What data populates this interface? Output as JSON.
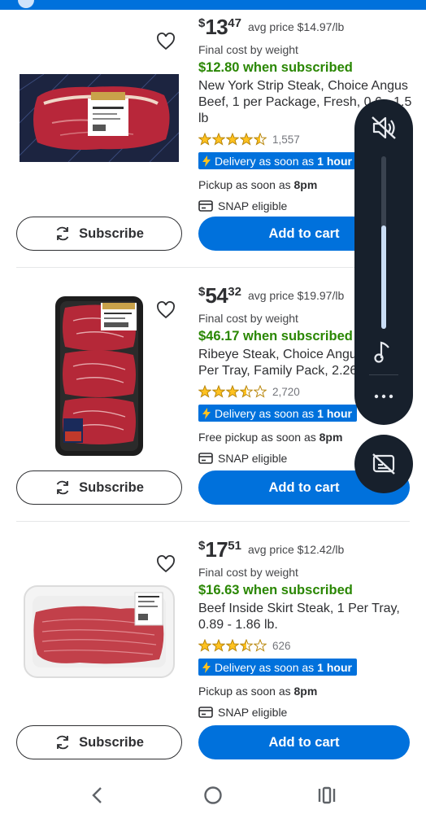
{
  "products": [
    {
      "price": {
        "dollar_sign": "$",
        "whole": "13",
        "cents": "47"
      },
      "avg_price": "avg price  $14.97/lb",
      "final_cost": "Final cost by weight",
      "subscribed": "$12.80 when subscribed",
      "title_lines": [
        "New York Strip Steak, Choice Angus",
        "Beef, 1 per Package, Fresh, 0.6 - 1.5",
        "lb"
      ],
      "rating": 4.5,
      "rating_count": "1,557",
      "delivery_prefix": "Delivery as soon as",
      "delivery_time": "1 hour",
      "pickup_prefix": "Pickup as soon as",
      "pickup_time": "8pm",
      "snap": "SNAP eligible",
      "subscribe_label": "Subscribe",
      "cart_label": "Add to cart",
      "image_icon": "ny-strip-steak-package"
    },
    {
      "price": {
        "dollar_sign": "$",
        "whole": "54",
        "cents": "32"
      },
      "avg_price": "avg price  $19.97/lb",
      "final_cost": "Final cost by weight",
      "subscribed": "$46.17 when subscribed",
      "title_lines": [
        "Ribeye Steak, Choice Angu",
        "Per Tray, Family Pack, 2.26"
      ],
      "rating": 3.5,
      "rating_count": "2,720",
      "delivery_prefix": "Delivery as soon as",
      "delivery_time": "1 hour",
      "pickup_prefix": "Free pickup as soon as",
      "pickup_time": "8pm",
      "snap": "SNAP eligible",
      "subscribe_label": "Subscribe",
      "cart_label": "Add to cart",
      "image_icon": "ribeye-steak-tray"
    },
    {
      "price": {
        "dollar_sign": "$",
        "whole": "17",
        "cents": "51"
      },
      "avg_price": "avg price  $12.42/lb",
      "final_cost": "Final cost by weight",
      "subscribed": "$16.63 when subscribed",
      "title_lines": [
        "Beef Inside Skirt Steak, 1 Per Tray,",
        "0.89 - 1.86 lb."
      ],
      "rating": 3.5,
      "rating_count": "626",
      "delivery_prefix": "Delivery as soon as",
      "delivery_time": "1 hour",
      "pickup_prefix": "Pickup as soon as",
      "pickup_time": "8pm",
      "snap": "SNAP eligible",
      "subscribe_label": "Subscribe",
      "cart_label": "Add to cart",
      "image_icon": "skirt-steak-tray"
    }
  ],
  "volume_panel": {
    "mute_icon": "volume-muted-icon",
    "level": 0.6,
    "music_icon": "music-note-icon",
    "more_icon": "more-options-icon",
    "caption_icon": "live-caption-off-icon"
  },
  "colors": {
    "brand_blue": "#0071dc",
    "subscribe_green": "#2a8703",
    "star_gold": "#ffc220",
    "panel_dark": "#17202c"
  },
  "system_nav": {
    "back_icon": "back-icon",
    "home_icon": "home-icon",
    "recents_icon": "recents-icon"
  }
}
